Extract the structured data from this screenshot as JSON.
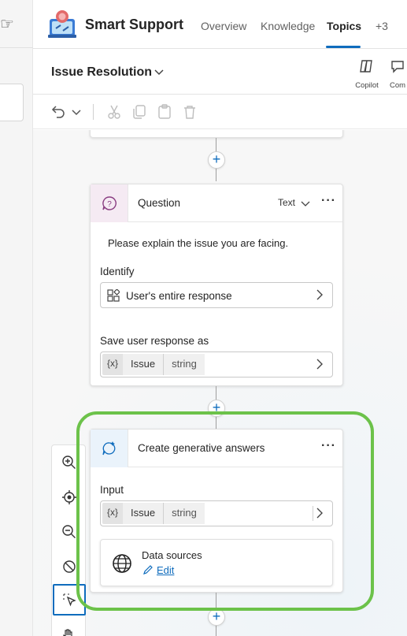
{
  "app": {
    "title": "Smart Support"
  },
  "nav": {
    "tabs": [
      "Overview",
      "Knowledge",
      "Topics",
      "+3"
    ],
    "active": "Topics"
  },
  "topic": {
    "title": "Issue Resolution"
  },
  "actions": {
    "copilot": "Copilot",
    "comments": "Com"
  },
  "question_node": {
    "title": "Question",
    "type": "Text",
    "message": "Please explain the issue you are facing.",
    "identify_label": "Identify",
    "identify_value": "User's entire response",
    "save_label": "Save user response as",
    "variable": {
      "symbol": "{x}",
      "name": "Issue",
      "type": "string"
    }
  },
  "gen_node": {
    "title": "Create generative answers",
    "input_label": "Input",
    "variable": {
      "symbol": "{x}",
      "name": "Issue",
      "type": "string"
    },
    "data_sources_label": "Data sources",
    "edit_label": "Edit"
  },
  "colors": {
    "accent": "#0f6cbd",
    "highlight": "#6cc24a",
    "question_icon_bg": "#f5eaf3",
    "gen_icon_bg": "#eaf3fb"
  }
}
